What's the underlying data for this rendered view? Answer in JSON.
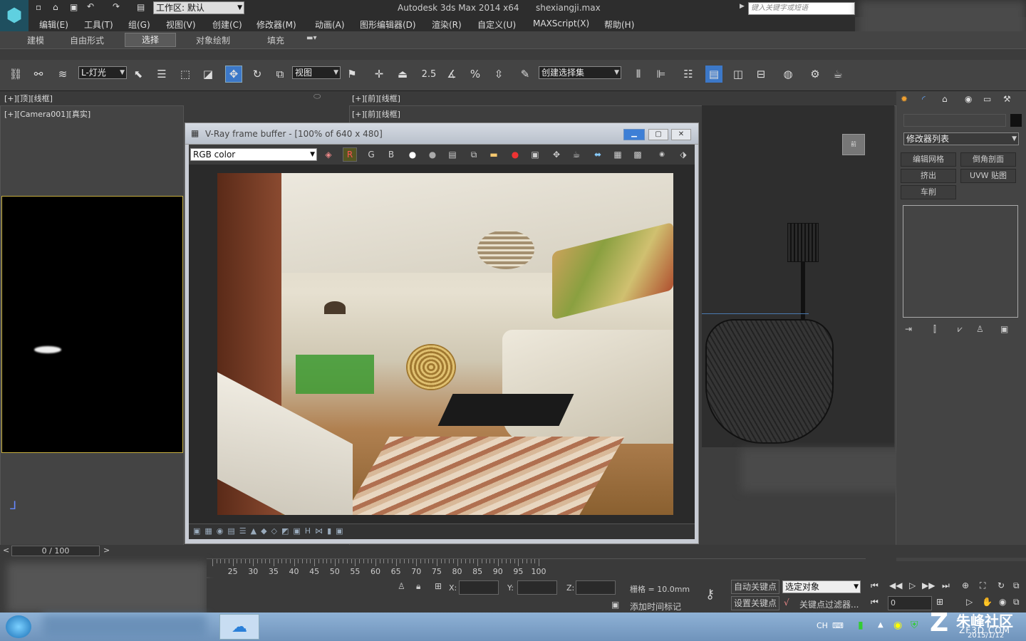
{
  "app": {
    "title": "Autodesk 3ds Max  2014 x64",
    "filename": "shexiangji.max",
    "workspace": "工作区: 默认",
    "search_placeholder": "键入关键字或短语"
  },
  "menu": [
    "编辑(E)",
    "工具(T)",
    "组(G)",
    "视图(V)",
    "创建(C)",
    "修改器(M)",
    "动画(A)",
    "图形编辑器(D)",
    "渲染(R)",
    "自定义(U)",
    "MAXScript(X)",
    "帮助(H)"
  ],
  "ribbon_tabs": [
    "建模",
    "自由形式",
    "选择",
    "对象绘制",
    "填充"
  ],
  "toolbar": {
    "filter": "L-灯光",
    "ref_coord": "视图",
    "selection_set": "创建选择集",
    "snap_label": "2.5",
    "percent_snap": "%"
  },
  "viewports": {
    "top_left_label": "[+][顶][线框]",
    "top_right_label": "[+][前][线框]",
    "camera_label": "[+][Camera001][真实]",
    "front_label": "[+][前][线框]"
  },
  "vfb": {
    "title": "V-Ray frame buffer - [100% of 640 x 480]",
    "channel": "RGB color",
    "buttons": [
      "R",
      "G",
      "B"
    ]
  },
  "command_panel": {
    "modifier_list": "修改器列表",
    "buttons": [
      "编辑网格",
      "倒角剖面",
      "挤出",
      "UVW 贴图",
      "车削"
    ]
  },
  "timeline": {
    "frame": "0 / 100",
    "ticks": [
      "25",
      "30",
      "35",
      "40",
      "45",
      "50",
      "55",
      "60",
      "65",
      "70",
      "75",
      "80",
      "85",
      "90",
      "95",
      "100"
    ]
  },
  "status": {
    "x_label": "X:",
    "y_label": "Y:",
    "z_label": "Z:",
    "grid": "栅格 = 10.0mm",
    "add_time_tag": "添加时间标记",
    "auto_key": "自动关键点",
    "set_key": "设置关键点",
    "selected": "选定对象",
    "key_filter": "关键点过滤器...",
    "frame_value": "0"
  },
  "taskbar": {
    "lang": "CH",
    "watermark": "朱峰社区",
    "watermark_sub": "ZF3D.COM",
    "date": "2015/1/12"
  }
}
